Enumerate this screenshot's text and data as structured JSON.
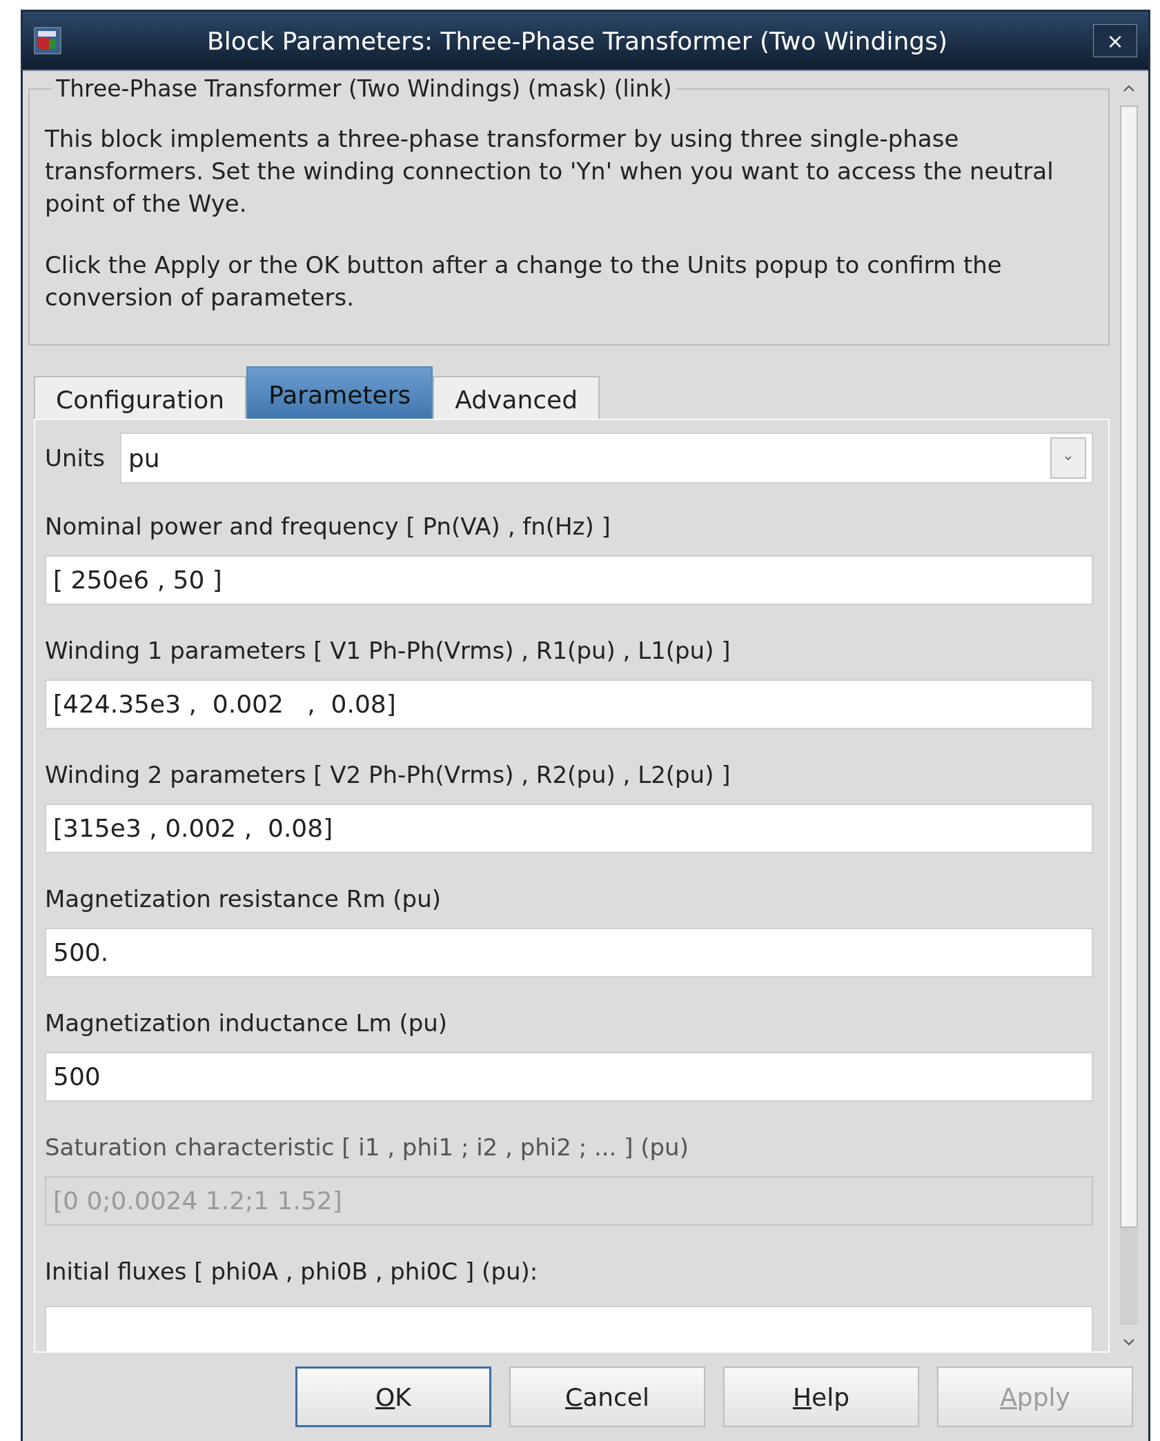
{
  "window": {
    "title": "Block Parameters: Three-Phase Transformer (Two Windings)",
    "close": "×"
  },
  "group": {
    "title": "Three-Phase Transformer (Two Windings) (mask) (link)",
    "paragraphs": [
      "This block implements a three-phase transformer by using three single-phase transformers. Set the winding connection to 'Yn'  when you want to access the neutral point of the Wye.",
      "Click the Apply or the OK button after a change to the Units popup to confirm the conversion of parameters."
    ]
  },
  "tabs": [
    {
      "label": "Configuration",
      "selected": false
    },
    {
      "label": "Parameters",
      "selected": true
    },
    {
      "label": "Advanced",
      "selected": false
    }
  ],
  "parameters": [
    {
      "kind": "dropdown",
      "label": "Units",
      "value": "pu"
    },
    {
      "kind": "text",
      "label": "Nominal power and frequency  [ Pn(VA) , fn(Hz) ]",
      "value": "[ 250e6 , 50 ]",
      "disabled": false
    },
    {
      "kind": "text",
      "label": "Winding 1 parameters [ V1 Ph-Ph(Vrms) , R1(pu) , L1(pu) ]",
      "value": "[424.35e3 ,  0.002   ,  0.08]",
      "disabled": false
    },
    {
      "kind": "text",
      "label": "Winding 2 parameters [ V2 Ph-Ph(Vrms) , R2(pu) , L2(pu) ]",
      "value": "[315e3 , 0.002 ,  0.08]",
      "disabled": false
    },
    {
      "kind": "text",
      "label": "Magnetization resistance  Rm (pu)",
      "value": "500.",
      "disabled": false
    },
    {
      "kind": "text",
      "label": "Magnetization inductance  Lm (pu)",
      "value": "500",
      "disabled": false
    },
    {
      "kind": "text",
      "label": "Saturation characteristic [ i1 ,  phi1 ;  i2 , phi2 ; ... ] (pu)",
      "value": "[0 0;0.0024 1.2;1 1.52]",
      "disabled": true
    },
    {
      "kind": "cut",
      "label": "Initial fluxes [ phi0A , phi0B , phi0C ] (pu):"
    }
  ],
  "buttons": [
    {
      "label": "OK",
      "default": true,
      "disabled": false
    },
    {
      "label": "Cancel",
      "default": false,
      "disabled": false
    },
    {
      "label": "Help",
      "default": false,
      "disabled": false
    },
    {
      "label": "Apply",
      "default": false,
      "disabled": true
    }
  ]
}
